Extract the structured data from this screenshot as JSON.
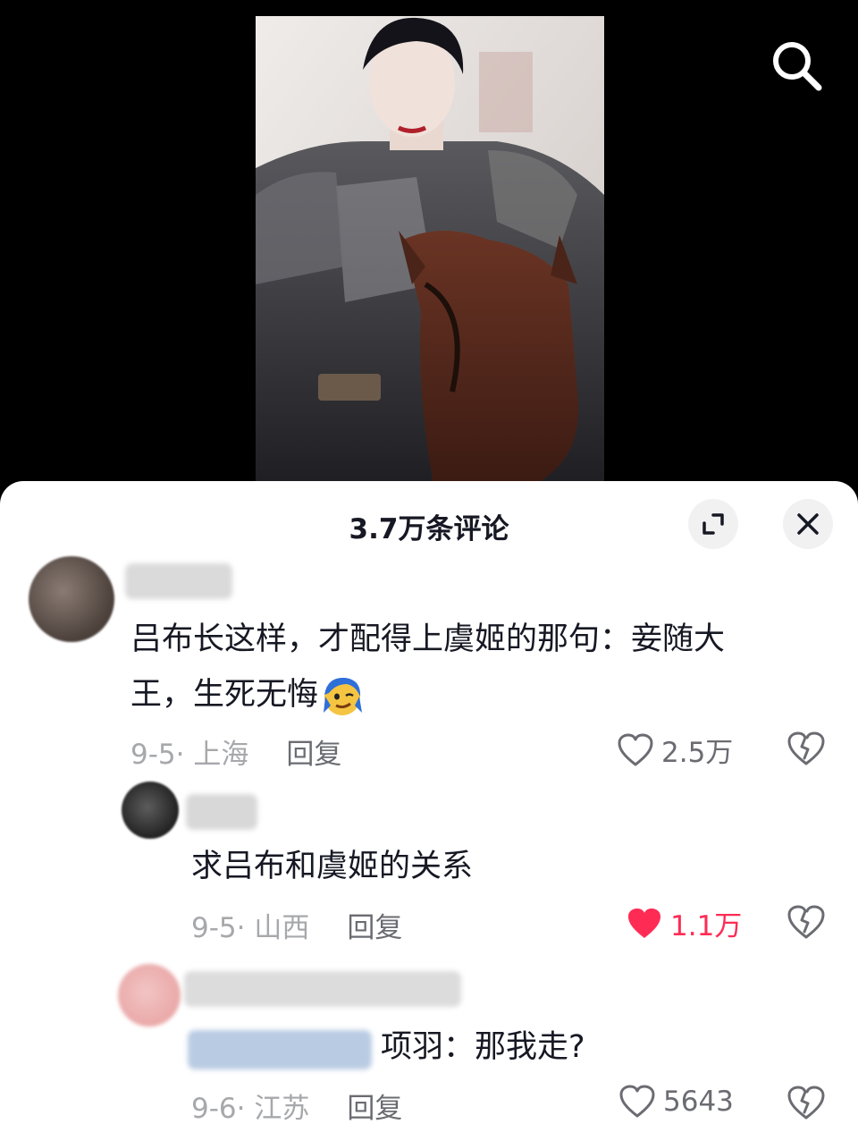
{
  "video": {
    "search_icon": "search-icon"
  },
  "comments_panel": {
    "title": "3.7万条评论",
    "expand_icon": "expand-icon",
    "close_icon": "close-icon",
    "comments": [
      {
        "text_line1": "吕布长这样，才配得上虞姬的那句：妾随大",
        "text_line2": "王，生死无悔",
        "emoji": "smug-emoji",
        "date": "9-5",
        "location": "上海",
        "reply_label": "回复",
        "like_count": "2.5万",
        "liked": false
      },
      {
        "text": "求吕布和虞姬的关系",
        "date": "9-5",
        "location": "山西",
        "reply_label": "回复",
        "like_count": "1.1万",
        "liked": true
      },
      {
        "text": "项羽：那我走?",
        "date": "9-6",
        "location": "江苏",
        "reply_label": "回复",
        "like_count": "5643",
        "liked": false
      }
    ]
  },
  "colors": {
    "liked": "#fe2c55",
    "meta": "#a7a8ab",
    "text": "#161823"
  }
}
